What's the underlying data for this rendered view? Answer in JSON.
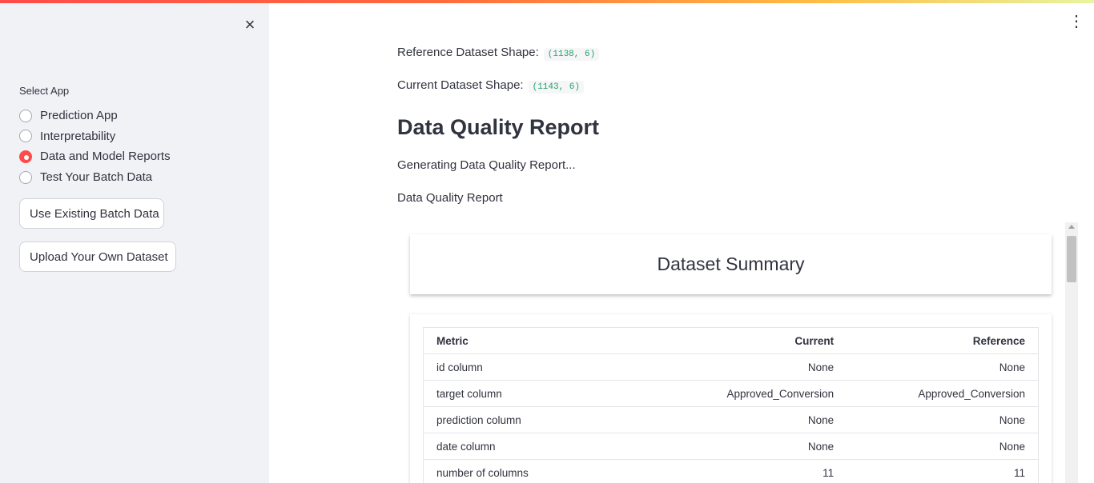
{
  "sidebar": {
    "close_icon": "×",
    "select_label": "Select App",
    "options": [
      {
        "label": "Prediction App",
        "selected": false
      },
      {
        "label": "Interpretability",
        "selected": false
      },
      {
        "label": "Data and Model Reports",
        "selected": true
      },
      {
        "label": "Test Your Batch Data",
        "selected": false
      }
    ],
    "btn_existing": "Use Existing Batch Data",
    "btn_upload": "Upload Your Own Dataset"
  },
  "header": {
    "menu_icon": "⋮"
  },
  "main": {
    "ref_shape_label": "Reference Dataset Shape:",
    "ref_shape_value": "(1138, 6)",
    "cur_shape_label": "Current Dataset Shape:",
    "cur_shape_value": "(1143, 6)",
    "heading": "Data Quality Report",
    "generating": "Generating Data Quality Report...",
    "report_label": "Data Quality Report"
  },
  "report": {
    "summary_title": "Dataset Summary",
    "columns": [
      "Metric",
      "Current",
      "Reference"
    ],
    "rows": [
      [
        "id column",
        "None",
        "None"
      ],
      [
        "target column",
        "Approved_Conversion",
        "Approved_Conversion"
      ],
      [
        "prediction column",
        "None",
        "None"
      ],
      [
        "date column",
        "None",
        "None"
      ],
      [
        "number of columns",
        "11",
        "11"
      ]
    ]
  },
  "colors": {
    "accent": "#ff4b4b",
    "code_text": "#21a366",
    "sidebar_bg": "#f0f2f6"
  }
}
